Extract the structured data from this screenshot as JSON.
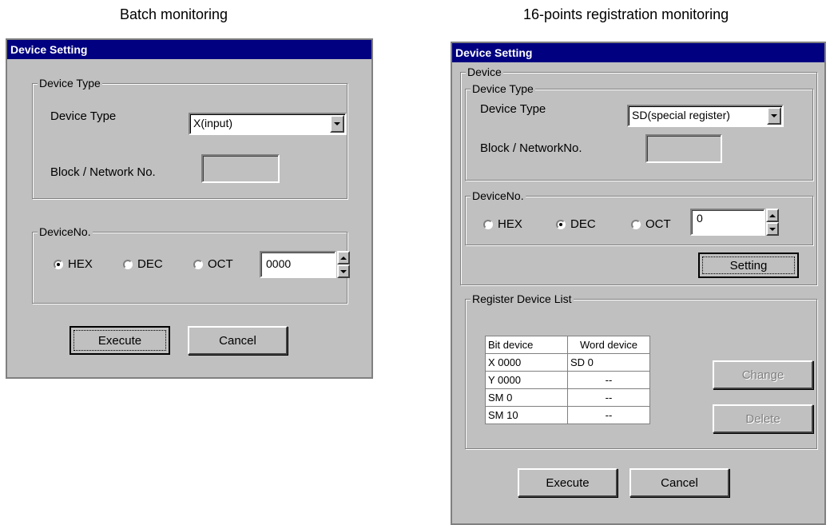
{
  "captions": {
    "left": "Batch monitoring",
    "right": "16-points registration monitoring"
  },
  "left_dialog": {
    "title": "Device Setting",
    "device_type_group": {
      "legend": "Device Type",
      "device_type_label": "Device Type",
      "device_type_value": "X(input)",
      "block_label": "Block / Network No.",
      "block_value": ""
    },
    "device_no_group": {
      "legend": "DeviceNo.",
      "radios": [
        "HEX",
        "DEC",
        "OCT"
      ],
      "selected": "HEX",
      "value": "0000"
    },
    "execute_label": "Execute",
    "cancel_label": "Cancel"
  },
  "right_dialog": {
    "title": "Device Setting",
    "device_group": {
      "legend": "Device",
      "device_type_group": {
        "legend": "Device Type",
        "device_type_label": "Device Type",
        "device_type_value": "SD(special register)",
        "block_label": "Block / NetworkNo.",
        "block_value": ""
      },
      "device_no_group": {
        "legend": "DeviceNo.",
        "radios": [
          "HEX",
          "DEC",
          "OCT"
        ],
        "selected": "DEC",
        "value": "0"
      },
      "setting_label": "Setting"
    },
    "register_group": {
      "legend": "Register Device List",
      "columns": [
        "Bit device",
        "Word device"
      ],
      "rows": [
        [
          "X 0000",
          "SD 0"
        ],
        [
          "Y 0000",
          "--"
        ],
        [
          "SM 0",
          "--"
        ],
        [
          "SM 10",
          "--"
        ]
      ],
      "change_label": "Change",
      "delete_label": "Delete"
    },
    "execute_label": "Execute",
    "cancel_label": "Cancel"
  }
}
